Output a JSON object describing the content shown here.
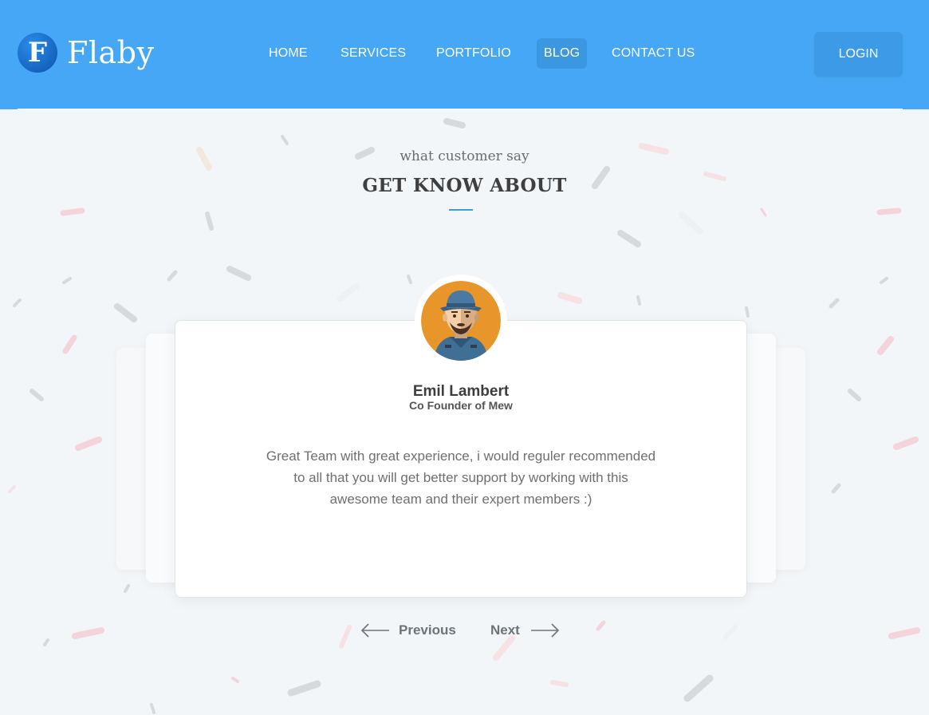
{
  "brand": {
    "logo_letter": "F",
    "name": "Flaby"
  },
  "nav": {
    "items": [
      {
        "label": "HOME"
      },
      {
        "label": "SERVICES"
      },
      {
        "label": "PORTFOLIO"
      },
      {
        "label": "BLOG",
        "active": true
      },
      {
        "label": "CONTACT US"
      }
    ],
    "login_label": "LOGIN"
  },
  "section": {
    "eyebrow": "what customer say",
    "title": "GET KNOW ABOUT"
  },
  "testimonial": {
    "avatar_icon": "user-avatar-icon",
    "name": "Emil Lambert",
    "role": "Co Founder of Mew",
    "quote_lines": [
      "Great Team with great experience, i would reguler recommended",
      "to all that you will get better support by working with this",
      "awesome team and their expert members :)"
    ]
  },
  "pager": {
    "previous_label": "Previous",
    "next_label": "Next",
    "prev_icon": "arrow-left-icon",
    "next_icon": "arrow-right-icon"
  },
  "colors": {
    "header": "#45a7f5",
    "background": "#f2f6f9",
    "accent_underline": "#3aa0d8",
    "avatar_bg": "#e8962a"
  }
}
